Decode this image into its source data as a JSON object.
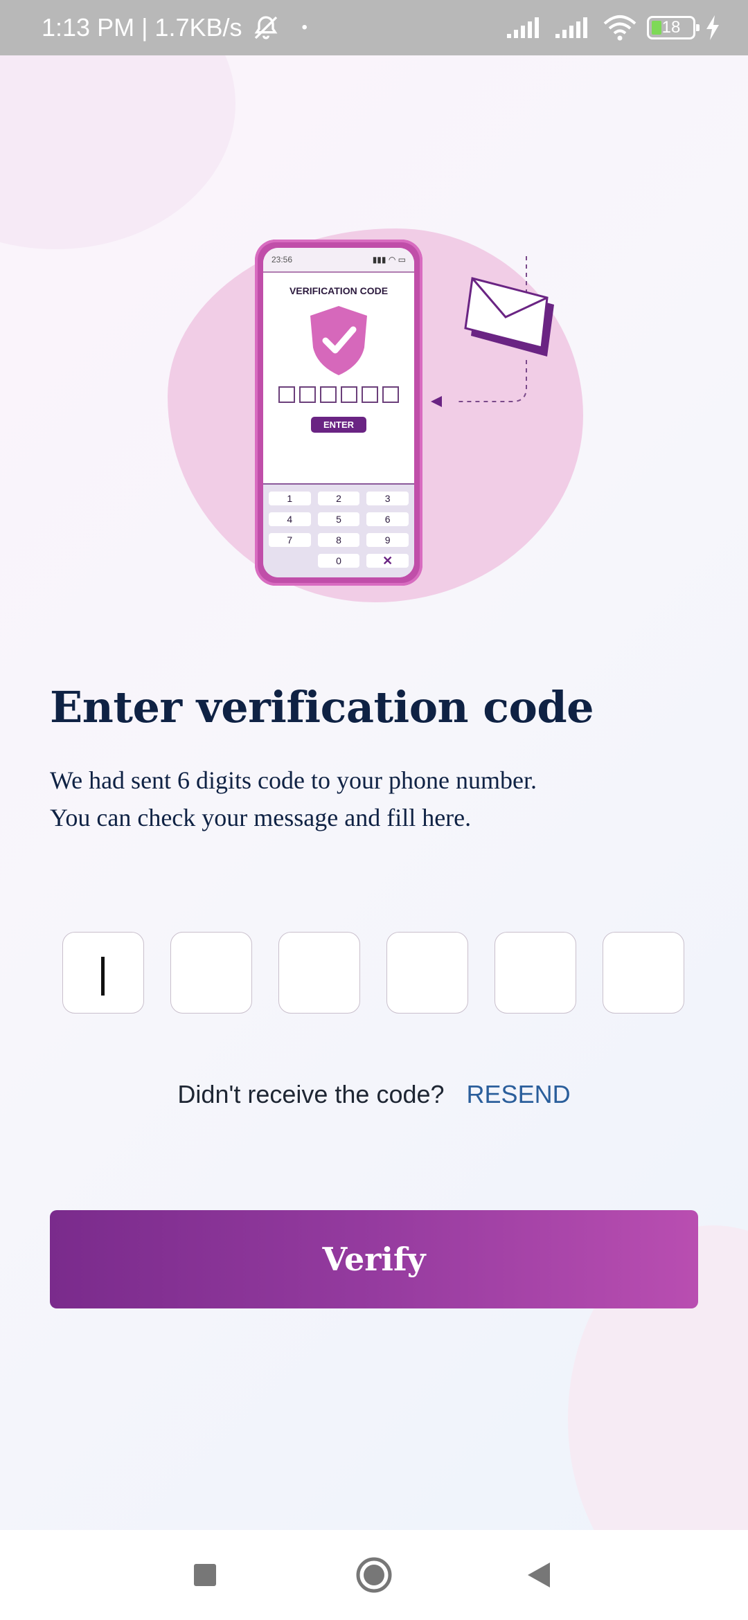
{
  "status_bar": {
    "left_text": "1:13 PM | 1.7KB/s",
    "battery_level": "18",
    "icons": [
      "bell-muted-icon",
      "signal-icon",
      "signal-icon",
      "wifi-icon",
      "battery-icon",
      "charging-icon"
    ]
  },
  "illustration": {
    "phone_time": "23:56",
    "phone_title": "VERIFICATION CODE",
    "phone_button": "ENTER",
    "keypad": [
      "1",
      "2",
      "3",
      "4",
      "5",
      "6",
      "7",
      "8",
      "9",
      "",
      "0",
      "✕"
    ]
  },
  "main": {
    "heading": "Enter verification code",
    "subtitle_line1": "We had sent 6 digits code to your phone number.",
    "subtitle_line2": "You can check your message and fill here.",
    "otp_digits": [
      "",
      "",
      "",
      "",
      "",
      ""
    ],
    "resend_prompt": "Didn't receive the code?",
    "resend_link": "RESEND",
    "verify_label": "Verify"
  },
  "colors": {
    "heading": "#0f2244",
    "link": "#2a5e9b",
    "button_start": "#7a2b8c",
    "button_end": "#b94eb1"
  },
  "nav_bar": {
    "icons": [
      "recent-apps-icon",
      "home-icon",
      "back-icon"
    ]
  }
}
